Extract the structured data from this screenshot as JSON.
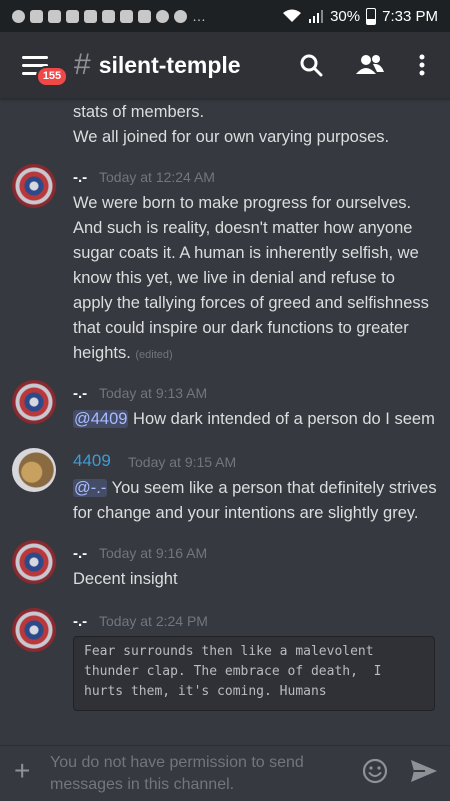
{
  "status_bar": {
    "battery": "30%",
    "time": "7:33 PM",
    "notification_icons": [
      "messenger-icon",
      "discord-icon",
      "discord-icon",
      "discord-icon",
      "discord-icon",
      "discord-icon",
      "shopping-bag-icon",
      "facebook-icon",
      "instagram-icon",
      "voicemail-icon"
    ],
    "overflow": "…"
  },
  "header": {
    "badge_count": "155",
    "hash": "#",
    "channel_name": "silent-temple"
  },
  "messages": [
    {
      "continuation": true,
      "lines": [
        "stats of members.",
        "We all joined for our own varying purposes."
      ]
    },
    {
      "author": "-.-",
      "timestamp": "Today at 12:24 AM",
      "text": "We were born to make progress for ourselves. And such is reality, doesn't matter how anyone sugar coats it. A human is inherently selfish, we know this yet, we live in denial and refuse to apply the tallying forces of greed and selfishness that could inspire our dark functions to greater heights.",
      "edited": "(edited)"
    },
    {
      "author": "-.-",
      "timestamp": "Today at 9:13 AM",
      "mention": "@4409",
      "text": " How dark intended of a person do I seem"
    },
    {
      "author": "4409",
      "timestamp": "Today at 9:15 AM",
      "mention": "@-.-",
      "text": " You seem like a person that definitely strives for change and your intentions are slightly grey."
    },
    {
      "author": "-.-",
      "timestamp": "Today at 9:16 AM",
      "text": "Decent insight"
    },
    {
      "author": "-.-",
      "timestamp": "Today at 2:24 PM",
      "code": "Fear surrounds then like a malevolent\nthunder clap. The embrace of death,  I\nhurts them, it's coming. Humans"
    }
  ],
  "input": {
    "plus": "+",
    "placeholder": "You do not have permission to send messages in this channel."
  },
  "colors": {
    "background": "#36393f",
    "header": "#2f3136",
    "accent_blue": "#3e9bd6",
    "badge_red": "#f04747"
  }
}
